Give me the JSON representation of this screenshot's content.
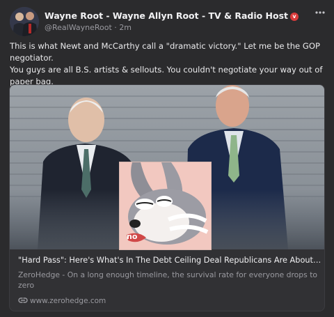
{
  "post": {
    "author": "Wayne Root - Wayne Allyn Root - TV & Radio Host",
    "verified_glyph": "v",
    "handle": "@RealWayneRoot",
    "time": "2m",
    "separator": " · ",
    "more_icon": "ellipsis-icon",
    "text": "This is what Newt and McCarthy call a \"dramatic victory.\" Let me be the GOP negotiator.\nYou guys are all B.S. artists & sellouts. You couldn't negotiate your way out of paper bag.\nThis is not \"victory.\" It's kicking can down road- same as always."
  },
  "card": {
    "title": "\"Hard Pass\": Here's What's In The Debt Ceiling Deal Republicans Are About To Vote On",
    "description": "ZeroHedge - On a long enough timeline, the survival rate for everyone drops to zero",
    "link": "www.zerohedge.com",
    "link_icon": "link-icon",
    "meme_text": "no"
  },
  "colors": {
    "background": "#2b2b2d",
    "verified": "#d93b3b",
    "muted": "#9a9aa0"
  }
}
